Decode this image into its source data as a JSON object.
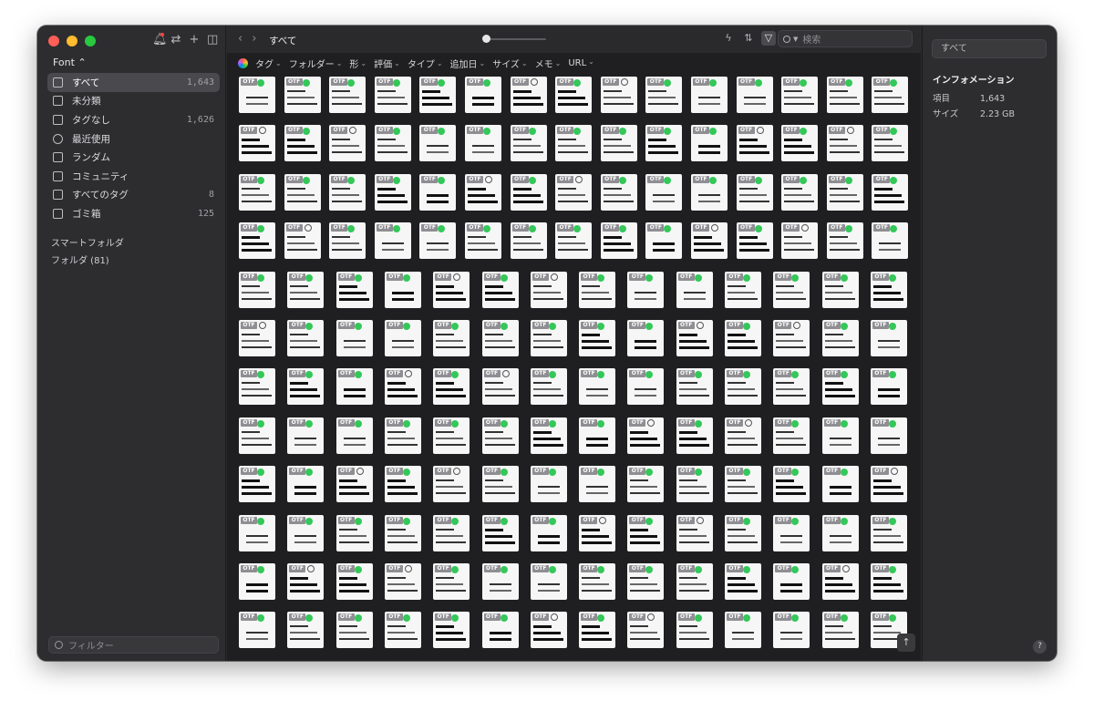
{
  "sidebar": {
    "library": "Font ⌃",
    "items": [
      {
        "label": "すべて",
        "count": "1,643"
      },
      {
        "label": "未分類",
        "count": ""
      },
      {
        "label": "タグなし",
        "count": "1,626"
      },
      {
        "label": "最近使用",
        "count": ""
      },
      {
        "label": "ランダム",
        "count": ""
      },
      {
        "label": "コミュニティ",
        "count": ""
      },
      {
        "label": "すべてのタグ",
        "count": "8"
      },
      {
        "label": "ゴミ箱",
        "count": "125"
      }
    ],
    "smart_folder": "スマートフォルダ",
    "folder": "フォルダ (81)",
    "filter_placeholder": "フィルター"
  },
  "toolbar": {
    "title": "すべて",
    "search_placeholder": "検索",
    "filters": [
      "タグ",
      "フォルダー",
      "形",
      "評価",
      "タイプ",
      "追加日",
      "サイズ",
      "メモ",
      "URL"
    ],
    "tile_badge": "OTF"
  },
  "inspector": {
    "field": "すべて",
    "heading": "インフォメーション",
    "rows": [
      {
        "key": "項目",
        "value": "1,643"
      },
      {
        "key": "サイズ",
        "value": "2.23 GB"
      }
    ]
  },
  "colors": {
    "accent_green": "#34c759",
    "window_bg": "#2a2a2d"
  }
}
